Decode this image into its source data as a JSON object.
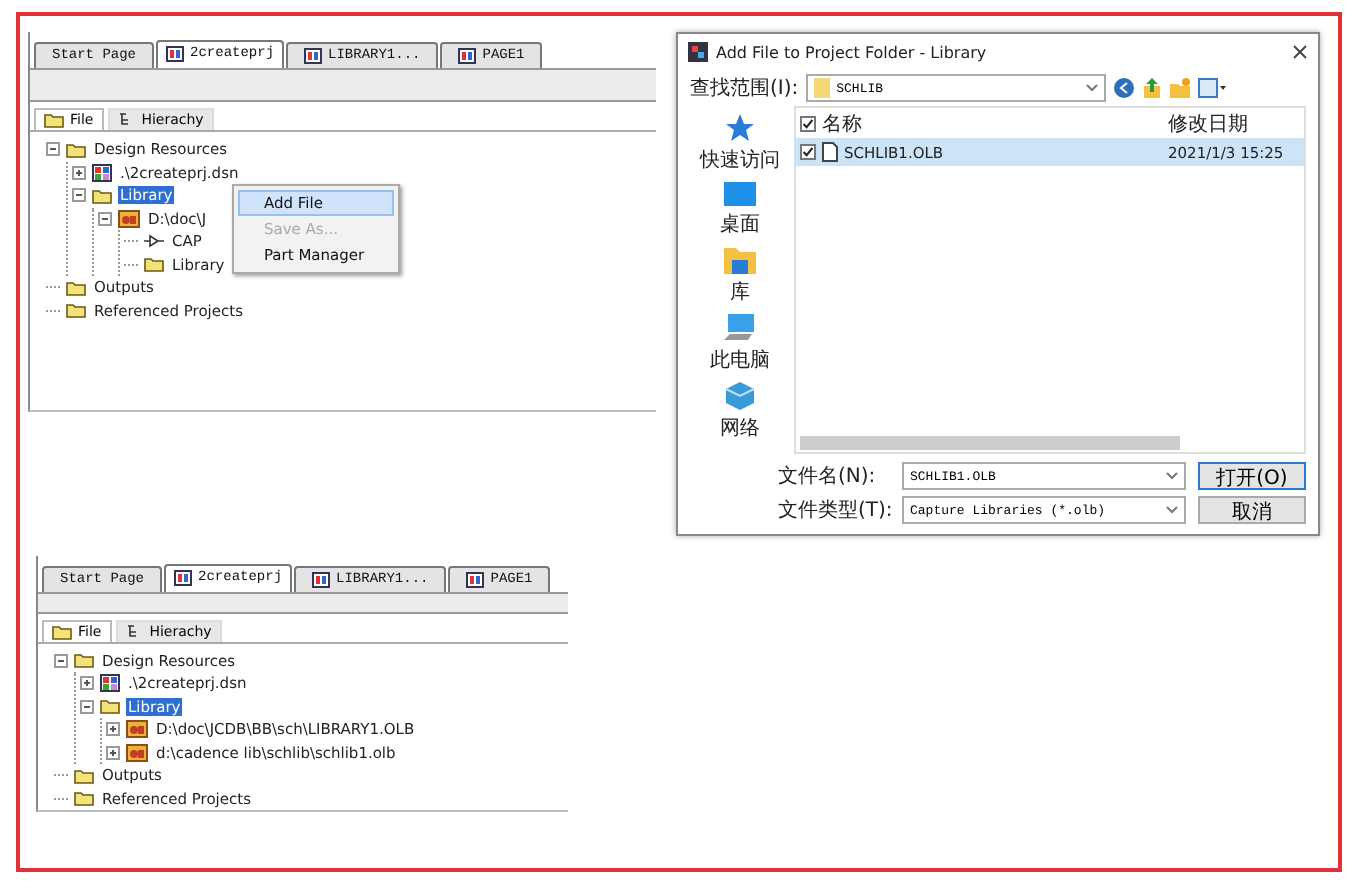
{
  "top_panel": {
    "tabs": [
      {
        "label": "Start Page",
        "icon": false,
        "selected": false
      },
      {
        "label": "2createprj",
        "icon": true,
        "selected": true
      },
      {
        "label": "LIBRARY1...",
        "icon": true,
        "selected": false
      },
      {
        "label": "PAGE1",
        "icon": true,
        "selected": false
      }
    ],
    "view_tabs": [
      {
        "label": "File",
        "selected": true
      },
      {
        "label": "Hierachy",
        "selected": false
      }
    ],
    "tree": [
      {
        "label": "Design Resources",
        "kind": "folder",
        "expanded": true,
        "selected": false,
        "children": [
          {
            "label": ".\\2createprj.dsn",
            "kind": "design",
            "expanded": false,
            "selected": false
          },
          {
            "label": "Library",
            "kind": "folder",
            "expanded": true,
            "selected": true,
            "children": [
              {
                "label": "D:\\doc\\J",
                "kind": "library",
                "expanded": true,
                "selected": false,
                "children": [
                  {
                    "label": "CAP",
                    "kind": "part",
                    "selected": false
                  },
                  {
                    "label": "Library",
                    "kind": "folder",
                    "selected": false
                  }
                ]
              }
            ]
          }
        ]
      },
      {
        "label": "Outputs",
        "kind": "folder",
        "selected": false
      },
      {
        "label": "Referenced Projects",
        "kind": "folder",
        "selected": false
      }
    ],
    "context_menu": [
      {
        "label": "Add File",
        "disabled": false,
        "selected": true
      },
      {
        "label": "Save As...",
        "disabled": true,
        "selected": false
      },
      {
        "label": "Part Manager",
        "disabled": false,
        "selected": false
      }
    ]
  },
  "dialog": {
    "title": "Add File to Project Folder - Library",
    "look_in_label": "查找范围(I):",
    "look_in_value": "SCHLIB",
    "places": [
      {
        "label": "快速访问",
        "kind": "star"
      },
      {
        "label": "桌面",
        "kind": "desktop"
      },
      {
        "label": "库",
        "kind": "library"
      },
      {
        "label": "此电脑",
        "kind": "computer"
      },
      {
        "label": "网络",
        "kind": "network"
      }
    ],
    "columns": [
      "名称",
      "修改日期"
    ],
    "select_all_checked": true,
    "files": [
      {
        "name": "SCHLIB1.OLB",
        "date": "2021/1/3 15:25",
        "checked": true,
        "selected": true
      }
    ],
    "filename_label": "文件名(N):",
    "filename": "SCHLIB1.OLB",
    "filetype_label": "文件类型(T):",
    "filetype": "Capture Libraries (*.olb)",
    "buttons": [
      "打开(O)",
      "取消"
    ]
  },
  "bottom_panel": {
    "tabs": [
      {
        "label": "Start Page",
        "icon": false,
        "selected": false
      },
      {
        "label": "2createprj",
        "icon": true,
        "selected": true
      },
      {
        "label": "LIBRARY1...",
        "icon": true,
        "selected": false
      },
      {
        "label": "PAGE1",
        "icon": true,
        "selected": false
      }
    ],
    "view_tabs": [
      {
        "label": "File",
        "selected": true
      },
      {
        "label": "Hierachy",
        "selected": false
      }
    ],
    "tree": [
      {
        "label": "Design Resources",
        "kind": "folder",
        "expanded": true,
        "selected": false,
        "children": [
          {
            "label": ".\\2createprj.dsn",
            "kind": "design",
            "expanded": false,
            "selected": false
          },
          {
            "label": "Library",
            "kind": "folder",
            "expanded": true,
            "selected": true,
            "children": [
              {
                "label": "D:\\doc\\JCDB\\BB\\sch\\LIBRARY1.OLB",
                "kind": "library",
                "expanded": false,
                "selected": false
              },
              {
                "label": "d:\\cadence lib\\schlib\\schlib1.olb",
                "kind": "library",
                "expanded": false,
                "selected": false
              }
            ]
          }
        ]
      },
      {
        "label": "Outputs",
        "kind": "folder",
        "selected": false
      },
      {
        "label": "Referenced Projects",
        "kind": "folder",
        "selected": false
      }
    ]
  }
}
